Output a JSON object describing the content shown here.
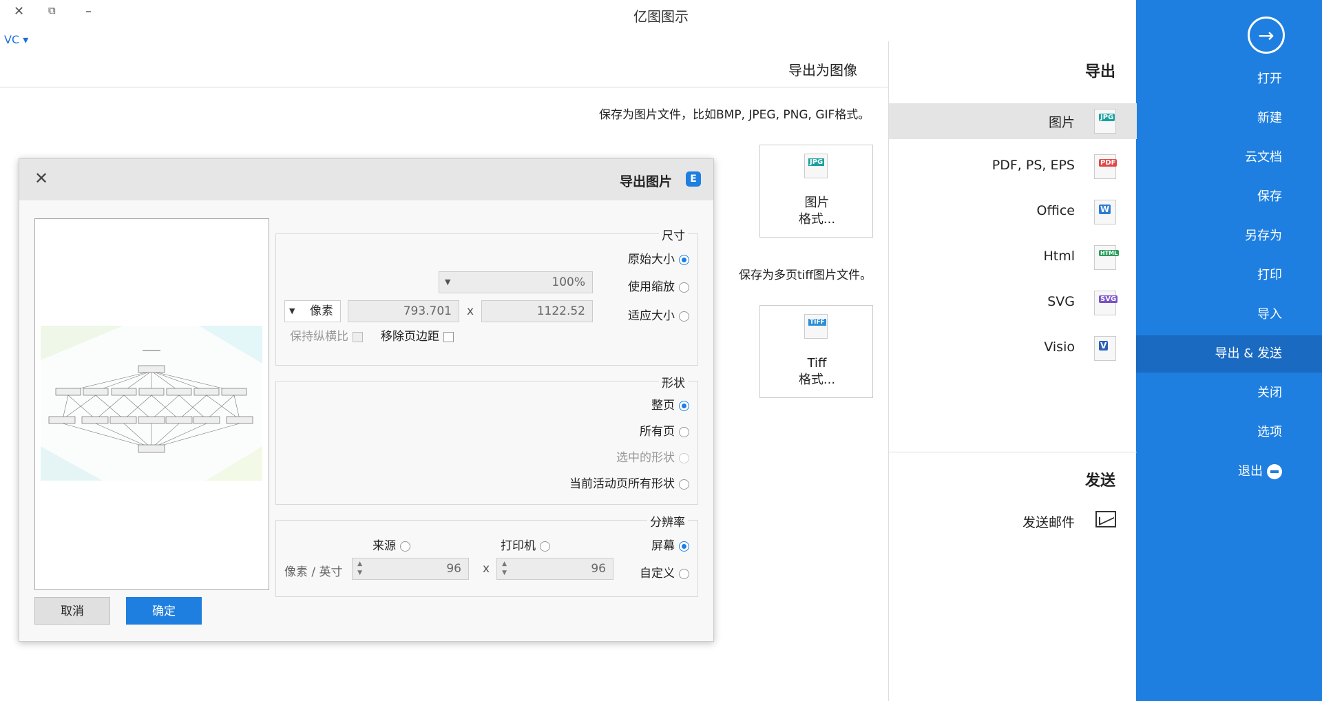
{
  "window": {
    "title": "亿图图示",
    "close": "✕",
    "restore": "⧉",
    "minimize": "–",
    "user": "VC ▾"
  },
  "sidebar": {
    "items": [
      {
        "label": "打开"
      },
      {
        "label": "新建"
      },
      {
        "label": "云文档"
      },
      {
        "label": "保存"
      },
      {
        "label": "另存为"
      },
      {
        "label": "打印"
      },
      {
        "label": "导入"
      },
      {
        "label": "导出 & 发送"
      },
      {
        "label": "关闭"
      },
      {
        "label": "选项"
      },
      {
        "label": "退出"
      }
    ],
    "active_index": 7,
    "color": "#1e7fe0"
  },
  "export_panel": {
    "heading": "导出",
    "items": [
      {
        "label": "图片",
        "badge": "JPG",
        "color": "#17a2a0"
      },
      {
        "label": "PDF, PS, EPS",
        "badge": "PDF",
        "color": "#e04848"
      },
      {
        "label": "Office",
        "badge": "W",
        "color": "#2b7cd3"
      },
      {
        "label": "Html",
        "badge": "HTML",
        "color": "#2a9d5a"
      },
      {
        "label": "SVG",
        "badge": "SVG",
        "color": "#7a52c8"
      },
      {
        "label": "Visio",
        "badge": "V",
        "color": "#2b5fb8"
      }
    ],
    "send_heading": "发送",
    "send_mail": "发送邮件"
  },
  "content": {
    "title": "导出为图像",
    "image_desc": "保存为图片文件，比如BMP, JPEG, PNG, GIF格式。",
    "image_card": {
      "badge": "JPG",
      "text": "图片\n格式..."
    },
    "tiff_desc": "保存为多页tiff图片文件。",
    "tiff_card": {
      "badge": "TIFF",
      "text": "Tiff\n格式..."
    }
  },
  "dialog": {
    "title": "导出图片",
    "close": "✕",
    "size_group": {
      "title": "尺寸",
      "original": "原始大小",
      "zoom": "使用缩放",
      "zoom_value": "100%",
      "fit": "适应大小",
      "width": "1122.52",
      "x": "x",
      "height": "793.701",
      "unit": "像素",
      "remove_margin": "移除页边距",
      "keep_ratio": "保持纵横比"
    },
    "shape_group": {
      "title": "形状",
      "whole_page": "整页",
      "all_pages": "所有页",
      "selected": "选中的形状",
      "current_all": "当前活动页所有形状"
    },
    "res_group": {
      "title": "分辨率",
      "screen": "屏幕",
      "printer": "打印机",
      "source": "来源",
      "custom": "自定义",
      "dpi1": "96",
      "x": "x",
      "dpi2": "96",
      "unit": "像素 / 英寸"
    },
    "ok": "确定",
    "cancel": "取消"
  }
}
